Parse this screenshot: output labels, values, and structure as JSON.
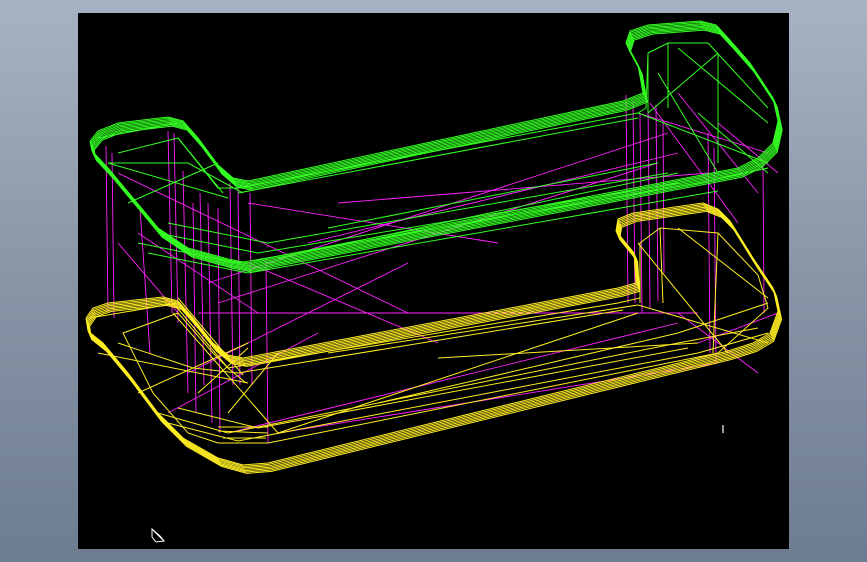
{
  "app": {
    "background_top": "#a7b3c2",
    "background_bottom": "#6e7c90"
  },
  "viewport": {
    "background": "#000000",
    "render_mode": "wireframe"
  },
  "model": {
    "upper_part": {
      "color": "#33ff22",
      "icon": "green-wireframe-tray"
    },
    "lower_part": {
      "color": "#ffee22",
      "icon": "yellow-wireframe-tray"
    },
    "hidden_edges": {
      "color": "#ff22ff"
    }
  },
  "ucs_icon": {
    "icon": "ucs-axis-icon",
    "color": "#ffffff"
  }
}
